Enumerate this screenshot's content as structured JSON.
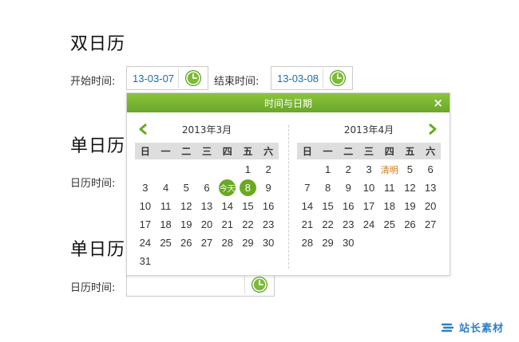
{
  "section1": {
    "title": "双日历",
    "start_label": "开始时间:",
    "start_value": "13-03-07",
    "end_label": "结束时间:",
    "end_value": "13-03-08"
  },
  "section2": {
    "title": "单日历",
    "label": "日历时间:"
  },
  "section3": {
    "title": "单日历",
    "label": "日历时间:",
    "value": ""
  },
  "popup": {
    "title": "时间与日期",
    "close": "×",
    "weekdays": [
      "日",
      "一",
      "二",
      "三",
      "四",
      "五",
      "六"
    ],
    "months": [
      {
        "title": "2013年3月",
        "days": [
          "",
          "",
          "",
          "",
          "",
          "1",
          "2",
          "3",
          "4",
          "5",
          "6",
          "今天",
          "8",
          "9",
          "10",
          "11",
          "12",
          "13",
          "14",
          "15",
          "16",
          "17",
          "18",
          "19",
          "20",
          "21",
          "22",
          "23",
          "24",
          "25",
          "26",
          "27",
          "28",
          "29",
          "30",
          "31"
        ],
        "today": "今天",
        "selected": "8"
      },
      {
        "title": "2013年4月",
        "days": [
          "",
          "1",
          "2",
          "3",
          "清明",
          "5",
          "6",
          "7",
          "8",
          "9",
          "10",
          "11",
          "12",
          "13",
          "14",
          "15",
          "16",
          "17",
          "18",
          "19",
          "20",
          "21",
          "22",
          "23",
          "24",
          "25",
          "26",
          "27",
          "28",
          "29",
          "30"
        ],
        "holiday": "清明"
      }
    ]
  },
  "watermark": {
    "text": "站长素材"
  },
  "colors": {
    "accent": "#6aaa22",
    "date_text": "#1a6fa8",
    "holiday": "#d07a14"
  },
  "icons": {
    "clock": "clock-icon",
    "prev": "chevron-left-icon",
    "next": "chevron-right-icon"
  }
}
